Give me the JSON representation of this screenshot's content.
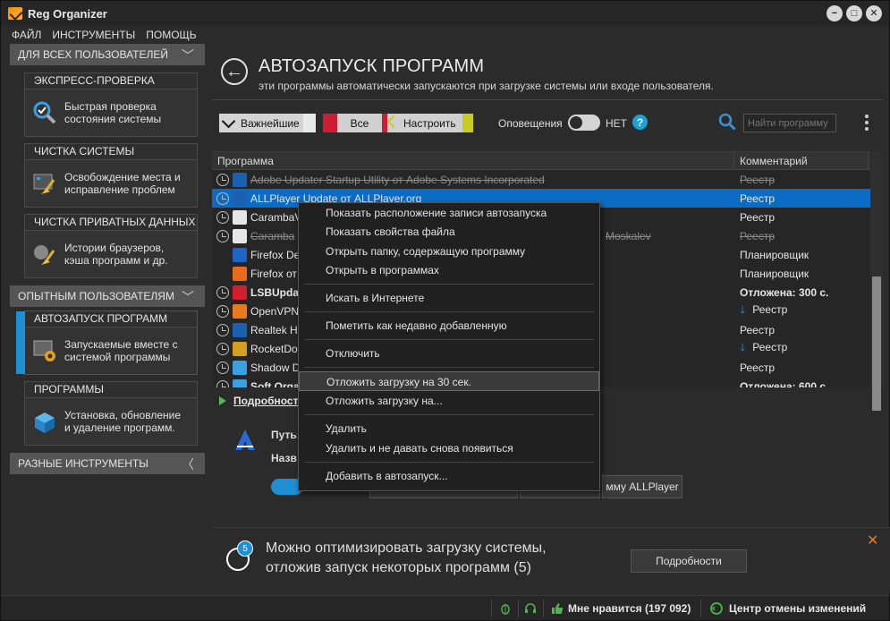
{
  "window": {
    "title": "Reg Organizer",
    "controls": [
      "−",
      "□",
      "✕"
    ]
  },
  "menu": [
    "ФАЙЛ",
    "ИНСТРУМЕНТЫ",
    "ПОМОЩЬ"
  ],
  "sidebar": {
    "section_all": "ДЛЯ ВСЕХ ПОЛЬЗОВАТЕЛЕЙ",
    "section_expert": "ОПЫТНЫМ ПОЛЬЗОВАТЕЛЯМ",
    "section_misc": "РАЗНЫЕ ИНСТРУМЕНТЫ",
    "cards": [
      {
        "title": "ЭКСПРЕСС-ПРОВЕРКА",
        "line1": "Быстрая проверка",
        "line2": "состояния системы",
        "icon": "magnifier-check-icon"
      },
      {
        "title": "ЧИСТКА СИСТЕМЫ",
        "line1": "Освобождение места и",
        "line2": "исправление проблем",
        "icon": "broom-icon"
      },
      {
        "title": "ЧИСТКА ПРИВАТНЫХ ДАННЫХ",
        "line1": "Истории браузеров,",
        "line2": "кэша программ и др.",
        "icon": "privacy-broom-icon"
      },
      {
        "title": "АВТОЗАПУСК ПРОГРАММ",
        "line1": "Запускаемые вместе с",
        "line2": "системой программы",
        "icon": "gear-window-icon"
      },
      {
        "title": "ПРОГРАММЫ",
        "line1": "Установка, обновление",
        "line2": "и удаление программ.",
        "icon": "package-icon"
      }
    ]
  },
  "main": {
    "title": "АВТОЗАПУСК ПРОГРАММ",
    "subtitle": "эти программы автоматически запускаются при загрузке системы или входе пользователя.",
    "filters": {
      "important": "Важнейшие",
      "all": "Все",
      "configure": "Настроить"
    },
    "notifications_label": "Оповещения",
    "notifications_state": "НЕТ",
    "search_placeholder": "Найти программу",
    "columns": {
      "program": "Программа",
      "comment": "Комментарий"
    },
    "rows": [
      {
        "name": "Adobe Updater Startup Utility от Adobe Systems Incorporated",
        "comment": "Реестр",
        "strike": true,
        "color": "#1b5fb0"
      },
      {
        "name": "ALLPlayer Update от ALLPlayer.org",
        "comment": "Реестр",
        "selected": true,
        "color": "#1b5fb0"
      },
      {
        "name": "CarambaV",
        "comment": "Реестр",
        "color": "#e6e6e6"
      },
      {
        "name": "Caramba",
        "name_tail": "Moskalev",
        "comment": "Реестр",
        "strike": true,
        "color": "#e6e6e6"
      },
      {
        "name": "Firefox De",
        "comment": "Планировщик",
        "color": "#1e63c8",
        "noclock": true
      },
      {
        "name": "Firefox от",
        "comment": "Планировщик",
        "color": "#e86a1a",
        "noclock": true
      },
      {
        "name": "LSBUpda",
        "comment": "Отложена: 300 с.",
        "bold": true,
        "color": "#d41d2d"
      },
      {
        "name": "OpenVPN",
        "comment": "Реестр",
        "color": "#e87a22",
        "arrow": true
      },
      {
        "name": "Realtek H",
        "comment": "Реестр",
        "color": "#1b5fb0"
      },
      {
        "name": "RocketDo",
        "comment": "Реестр",
        "color": "#d4a020",
        "arrow": true
      },
      {
        "name": "Shadow D",
        "comment": "Реестр",
        "color": "#3aa0e0"
      },
      {
        "name": "Soft Orga",
        "comment": "Отложена: 600 с.",
        "bold": true,
        "color": "#3aa0e0"
      }
    ],
    "details_tab": "Подробност",
    "path_label": "Путь:",
    "name_label": "Назв",
    "allplayer_button": "мму ALLPlayer"
  },
  "context_menu": [
    "Показать расположение записи автозапуска",
    "Показать свойства файла",
    "Открыть папку, содержащую программу",
    "Открыть в программах",
    "Искать в Интернете",
    "Пометить как недавно добавленную",
    "Отключить",
    "Отложить загрузку на 30 сек.",
    "Отложить загрузку на...",
    "Удалить",
    "Удалить и не давать снова появиться",
    "Добавить в автозапуск..."
  ],
  "notice": {
    "badge": "5",
    "line1": "Можно оптимизировать загрузку системы,",
    "line2": "отложив запуск некоторых программ (5)",
    "button": "Подробности"
  },
  "statusbar": {
    "like": "Мне нравится (197 092)",
    "undo_center": "Центр отмены изменений"
  }
}
